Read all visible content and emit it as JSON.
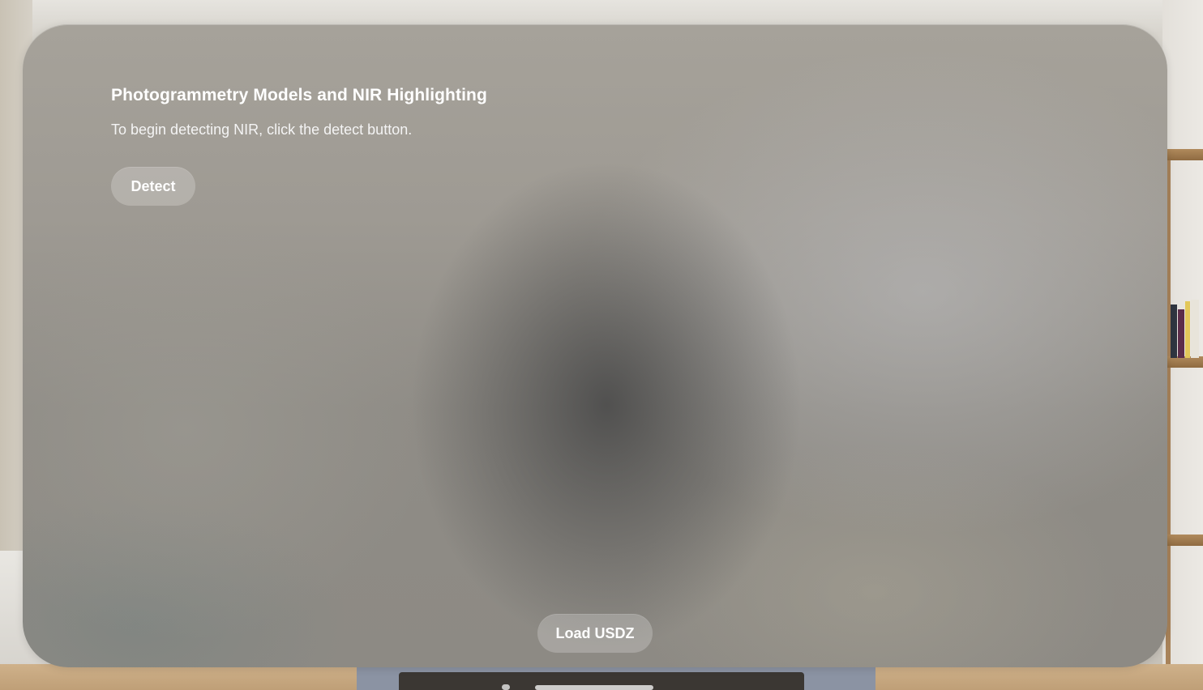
{
  "window": {
    "title": "Photogrammetry Models and NIR Highlighting",
    "subtitle": "To begin detecting NIR, click the detect button."
  },
  "buttons": {
    "detect_label": "Detect",
    "load_usdz_label": "Load USDZ"
  }
}
